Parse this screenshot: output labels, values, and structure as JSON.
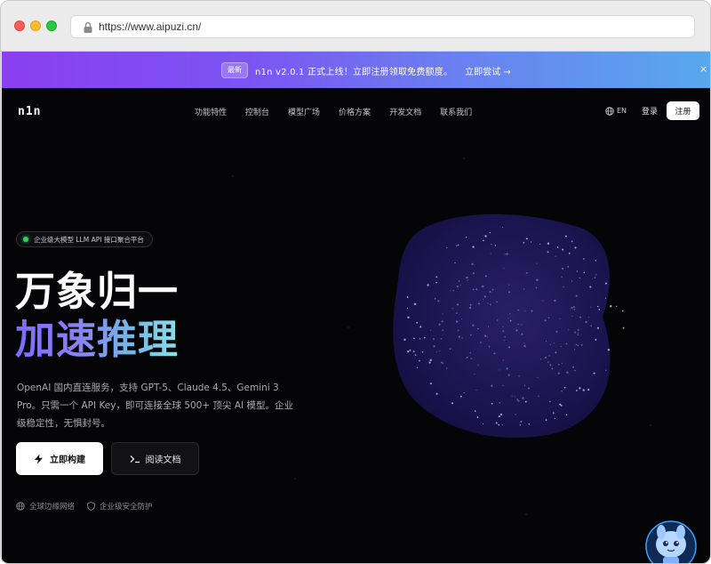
{
  "browser": {
    "url": "https://www.aipuzi.cn/"
  },
  "banner": {
    "badge": "最新",
    "text": "n1n v2.0.1 正式上线！立即注册领取免费额度。",
    "link": "立即尝试 →",
    "close": "×"
  },
  "nav": {
    "logo": "n1n",
    "items": [
      "功能特性",
      "控制台",
      "模型广场",
      "价格方案",
      "开发文档",
      "联系我们"
    ],
    "lang": "EN",
    "login": "登录",
    "signup": "注册"
  },
  "hero": {
    "pill": "企业级大模型 LLM API 接口聚合平台",
    "title_1": "万象归一",
    "title_2": "加速推理",
    "desc": "OpenAI 国内直连服务，支持 GPT-5、Claude 4.5、Gemini 3 Pro。只需一个 API Key，即可连接全球 500+ 顶尖 AI 模型。企业级稳定性，无惧封号。",
    "primary_button": "立即构建",
    "secondary_button": "阅读文档",
    "features": [
      "全球边缘网络",
      "企业级安全防护"
    ]
  },
  "colors": {
    "banner_start": "#8a3ff0",
    "banner_end": "#58a8ee",
    "accent_green": "#2bd35d",
    "page_bg": "#050507"
  },
  "icons": {
    "lock": "lock-icon",
    "globe": "globe-icon",
    "bolt": "bolt-icon",
    "terminal": "terminal-icon",
    "shield": "shield-icon",
    "close": "close-icon"
  }
}
